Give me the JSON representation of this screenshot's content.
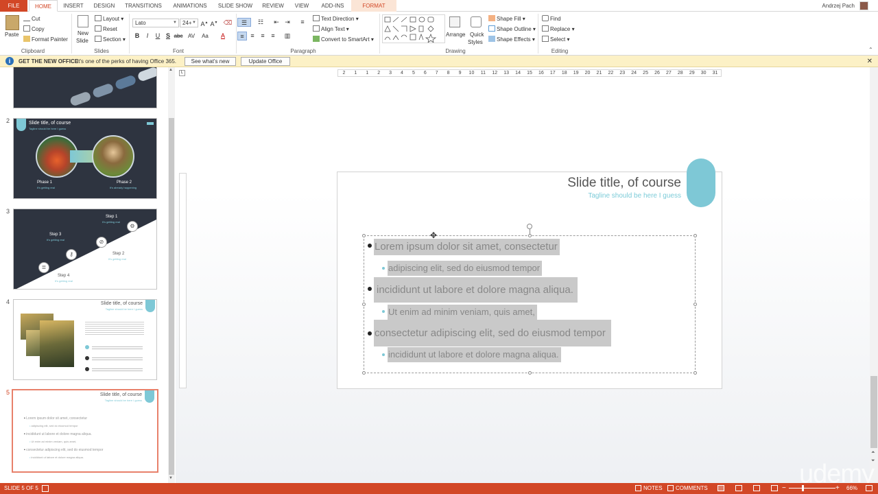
{
  "tabs": [
    "FILE",
    "HOME",
    "INSERT",
    "DESIGN",
    "TRANSITIONS",
    "ANIMATIONS",
    "SLIDE SHOW",
    "REVIEW",
    "VIEW",
    "ADD-INS",
    "FORMAT"
  ],
  "user_name": "Andrzej Pach",
  "ribbon": {
    "clipboard": {
      "paste": "Paste",
      "cut": "Cut",
      "copy": "Copy",
      "format_painter": "Format Painter",
      "label": "Clipboard"
    },
    "slides": {
      "new_slide_1": "New",
      "new_slide_2": "Slide",
      "layout": "Layout",
      "reset": "Reset",
      "section": "Section",
      "label": "Slides"
    },
    "font": {
      "name": "Lato",
      "size": "24+",
      "bold": "B",
      "italic": "I",
      "underline": "U",
      "strike": "S",
      "abc": "abc",
      "spacing": "AV",
      "case": "Aa",
      "color": "A",
      "label": "Font"
    },
    "paragraph": {
      "text_direction": "Text Direction",
      "align_text": "Align Text",
      "convert_smartart": "Convert to SmartArt",
      "label": "Paragraph"
    },
    "drawing": {
      "arrange": "Arrange",
      "quick_styles_1": "Quick",
      "quick_styles_2": "Styles",
      "shape_fill": "Shape Fill",
      "shape_outline": "Shape Outline",
      "shape_effects": "Shape Effects",
      "label": "Drawing"
    },
    "editing": {
      "find": "Find",
      "replace": "Replace",
      "select": "Select",
      "label": "Editing"
    }
  },
  "notification": {
    "title": "GET THE NEW OFFICE",
    "message": "It's one of the perks of having Office 365.",
    "see_whats_new": "See what's new",
    "update_office": "Update Office"
  },
  "ruler_h": [
    "2",
    "1",
    "1",
    "2",
    "3",
    "4",
    "5",
    "6",
    "7",
    "8",
    "9",
    "10",
    "11",
    "12",
    "13",
    "14",
    "15",
    "16",
    "17",
    "18",
    "19",
    "20",
    "21",
    "22",
    "23",
    "24",
    "25",
    "26",
    "27",
    "28",
    "29",
    "30",
    "31"
  ],
  "thumbnails": [
    {
      "num": "2",
      "title": "Slide title, of course",
      "tag": "Tagline should be here I guess",
      "phase1": "Phase 1",
      "phase1_sub": "It's getting real",
      "phase2": "Phase 2",
      "phase2_sub": "It's already happening"
    },
    {
      "num": "3",
      "step1": "Step 1",
      "step2": "Step 2",
      "step3": "Step 3",
      "step4": "Step 4",
      "sub": "It's getting real"
    },
    {
      "num": "4",
      "title": "Slide title, of course",
      "tag": "Tagline should be here I guess"
    },
    {
      "num": "5",
      "title": "Slide title, of course",
      "tag": "Tagline should be here I guess",
      "lines": [
        "Lorem ipsum dolor sit amet, consectetur",
        "adipiscing elit, sed do eiusmod tempor",
        "incididunt ut labore et dolore magna aliqua.",
        "Ut enim ad minim veniam, quis amet,",
        "consectetur adipiscing elit, sed do eiusmod tempor",
        "incididunt ut labore et dolore magna aliqua."
      ]
    }
  ],
  "slide": {
    "title": "Slide title, of course",
    "tagline": "Tagline should be here I guess",
    "bullets": [
      {
        "level": 1,
        "text": "Lorem ipsum dolor sit amet, consectetur"
      },
      {
        "level": 2,
        "text": "adipiscing elit, sed do eiusmod tempor"
      },
      {
        "level": 1,
        "text": "incididunt ut labore et dolore magna aliqua."
      },
      {
        "level": 2,
        "text": "Ut enim ad minim veniam, quis amet,"
      },
      {
        "level": 1,
        "text": "consectetur adipiscing elit, sed do eiusmod tempor"
      },
      {
        "level": 2,
        "text": "incididunt ut labore et dolore magna aliqua."
      }
    ]
  },
  "status": {
    "slide": "SLIDE 5 OF 5",
    "notes": "NOTES",
    "comments": "COMMENTS",
    "zoom": "66%"
  },
  "watermark": "udemy",
  "colors": {
    "accent": "#d24726",
    "teal": "#7ec8d6",
    "dark_slide": "#2e3440",
    "notif_bg": "#fcf1c6"
  }
}
